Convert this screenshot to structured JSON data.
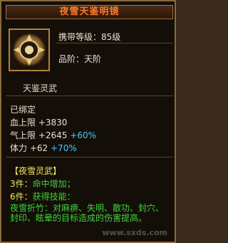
{
  "item": {
    "name": "夜雪天鉴明镜",
    "carry_level_label": "携带等级：",
    "carry_level_value": "85级",
    "grade_label": "品阶：",
    "grade_value": "天阶",
    "subtitle": "天鉴灵武"
  },
  "status": {
    "bound": "已绑定"
  },
  "stats": [
    {
      "label": "血上限",
      "value": "+3830",
      "extra": ""
    },
    {
      "label": "气上限",
      "value": "+2645",
      "extra": "+60%"
    },
    {
      "label": "体力",
      "value": "+62",
      "extra": "+70%"
    }
  ],
  "set": {
    "title": "【夜雪灵武】",
    "bonus3_label": "3件：",
    "bonus3_text": "命中增加；",
    "bonus6_label": "6件：",
    "bonus6_text": "获得技能：",
    "skill_text": "夜雪折竹：对麻痹、失明、散功、封穴、封印、眩晕的目标造成的伤害提高。"
  },
  "watermark": "www.sxds.com",
  "colors": {
    "title": "#ff7a2a",
    "green": "#3cd63c",
    "cyan": "#4ac8ff",
    "gold_border": "#b08040"
  },
  "icons": {
    "item": "mirror-emblem-icon"
  }
}
